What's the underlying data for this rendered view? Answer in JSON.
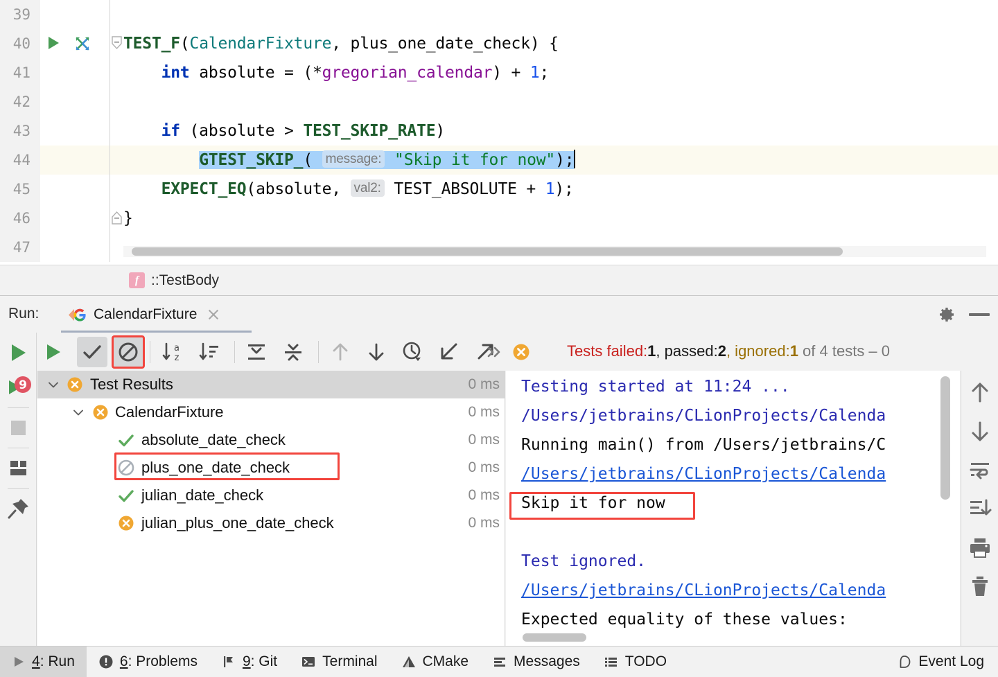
{
  "editor": {
    "lines": [
      {
        "no": "39",
        "segments": []
      },
      {
        "no": "40",
        "has_run_icon": true,
        "has_test_icon": true,
        "has_fold": "open",
        "text": "TEST_F(CalendarFixture, plus_one_date_check) {"
      },
      {
        "no": "41",
        "text": "    int absolute = (*gregorian_calendar) + 1;"
      },
      {
        "no": "42",
        "text": ""
      },
      {
        "no": "43",
        "text": "    if (absolute > TEST_SKIP_RATE)"
      },
      {
        "no": "44",
        "current": true,
        "text": "        GTEST_SKIP_( message: \"Skip it for now\");"
      },
      {
        "no": "45",
        "text": "    EXPECT_EQ(absolute,  val2: TEST_ABSOLUTE + 1);"
      },
      {
        "no": "46",
        "has_fold": "close",
        "text": "}"
      },
      {
        "no": "47",
        "text": ""
      }
    ],
    "hint_message": "message:",
    "hint_val2": "val2:",
    "code_tokens": {
      "l40_macro": "TEST_F",
      "l40_paren": "(",
      "l40_class": "CalendarFixture",
      "l40_rest": ", plus_one_date_check) {",
      "l41_indent": "    ",
      "l41_kw": "int",
      "l41_mid": " absolute = (*",
      "l41_field": "gregorian_calendar",
      "l41_end": ") + ",
      "l41_num": "1",
      "l41_semi": ";",
      "l43_indent": "    ",
      "l43_kw": "if",
      "l43_mid": " (absolute > ",
      "l43_const": "TEST_SKIP_RATE",
      "l43_end": ")",
      "l44_indent": "        ",
      "l44_macro": "GTEST_SKIP_",
      "l44_paren": "( ",
      "l44_str": "\"Skip it for now\"",
      "l44_end": ");",
      "l45_indent": "    ",
      "l45_macro": "EXPECT_EQ",
      "l45_mid": "(absolute, ",
      "l45_const": " TEST_ABSOLUTE + ",
      "l45_num": "1",
      "l45_end": ");",
      "l46_brace": "}"
    }
  },
  "breadcrumb": {
    "icon": "function-icon",
    "icon_letter": "f",
    "text": "::TestBody"
  },
  "run_header": {
    "label": "Run:",
    "tab_title": "CalendarFixture",
    "tab_icon": "gtest-icon",
    "close_icon": "close-icon",
    "gear_icon": "gear-icon",
    "minimize_icon": "minimize-icon"
  },
  "left_toolbar": {
    "buttons": [
      {
        "name": "rerun-button",
        "icon": "play-icon"
      },
      {
        "name": "rerun-failed-button",
        "icon": "play-failed-icon",
        "badge": "9"
      },
      {
        "name": "stop-button",
        "icon": "stop-icon"
      },
      {
        "name": "layout-button",
        "icon": "layout-icon"
      },
      {
        "name": "pin-tab-button",
        "icon": "pin-icon"
      }
    ]
  },
  "test_toolbar": {
    "buttons": [
      {
        "name": "rerun-tests-button",
        "icon": "play-icon",
        "state": "normal"
      },
      {
        "name": "show-passed-button",
        "icon": "check-icon",
        "state": "pressed"
      },
      {
        "name": "show-ignored-button",
        "icon": "ignored-icon",
        "state": "pressed-highlighted"
      },
      {
        "name": "sort-alphabetically-button",
        "icon": "sort-alpha-icon",
        "state": "normal"
      },
      {
        "name": "sort-by-duration-button",
        "icon": "sort-duration-icon",
        "state": "normal"
      },
      {
        "name": "expand-all-button",
        "icon": "expand-all-icon",
        "state": "normal"
      },
      {
        "name": "collapse-all-button",
        "icon": "collapse-all-icon",
        "state": "normal"
      },
      {
        "name": "previous-failed-button",
        "icon": "arrow-up-icon",
        "state": "disabled"
      },
      {
        "name": "next-failed-button",
        "icon": "arrow-down-icon",
        "state": "normal"
      },
      {
        "name": "test-history-button",
        "icon": "clock-dropdown-icon",
        "state": "normal"
      },
      {
        "name": "import-tests-button",
        "icon": "import-icon",
        "state": "normal"
      },
      {
        "name": "export-tests-button",
        "icon": "export-icon",
        "state": "normal"
      },
      {
        "name": "more-toolbar-button",
        "icon": "chevron-double-right-icon",
        "state": "normal"
      }
    ],
    "status": {
      "icon": "failed-icon",
      "failed_label": "Tests failed:",
      "failed_count": "1",
      "passed_label": ", passed:",
      "passed_count": "2",
      "ignored_label": ", ignored:",
      "ignored_count": "1",
      "total_text": " of 4 tests – 0"
    }
  },
  "test_tree": {
    "rows": [
      {
        "label": "Test Results",
        "time": "0 ms",
        "status": "failed",
        "indent": 0,
        "chevron": "expanded",
        "selected": true
      },
      {
        "label": "CalendarFixture",
        "time": "0 ms",
        "status": "failed",
        "indent": 1,
        "chevron": "expanded",
        "selected": false
      },
      {
        "label": "absolute_date_check",
        "time": "0 ms",
        "status": "passed",
        "indent": 2,
        "chevron": "none",
        "selected": false
      },
      {
        "label": "plus_one_date_check",
        "time": "0 ms",
        "status": "ignored",
        "indent": 2,
        "chevron": "none",
        "selected": false,
        "highlighted": true
      },
      {
        "label": "julian_date_check",
        "time": "0 ms",
        "status": "passed",
        "indent": 2,
        "chevron": "none",
        "selected": false
      },
      {
        "label": "julian_plus_one_date_check",
        "time": "0 ms",
        "status": "failed",
        "indent": 2,
        "chevron": "none",
        "selected": false
      }
    ]
  },
  "console": {
    "lines": [
      {
        "text": "Testing started at 11:24 ...",
        "style": "blue"
      },
      {
        "text": "/Users/jetbrains/CLionProjects/Calenda",
        "style": "blue"
      },
      {
        "text": "Running main() from /Users/jetbrains/C",
        "style": "black"
      },
      {
        "text": "/Users/jetbrains/CLionProjects/Calenda",
        "style": "link"
      },
      {
        "text": "Skip it for now",
        "style": "black",
        "highlighted": true
      },
      {
        "text": "",
        "style": "black"
      },
      {
        "text": "Test ignored.",
        "style": "blue"
      },
      {
        "text": "/Users/jetbrains/CLionProjects/Calenda",
        "style": "link"
      },
      {
        "text": "Expected equality of these values:",
        "style": "black"
      }
    ]
  },
  "right_toolbar": {
    "buttons": [
      {
        "name": "scroll-up-button",
        "icon": "arrow-up-icon"
      },
      {
        "name": "scroll-down-button",
        "icon": "arrow-down-icon"
      },
      {
        "name": "soft-wrap-button",
        "icon": "soft-wrap-icon"
      },
      {
        "name": "scroll-to-end-button",
        "icon": "scroll-end-icon"
      },
      {
        "name": "print-button",
        "icon": "print-icon"
      },
      {
        "name": "clear-all-button",
        "icon": "trash-icon"
      }
    ]
  },
  "status_bar": {
    "items": [
      {
        "name": "statusbar-run",
        "num": "4",
        "label": ": Run",
        "icon": "play-icon",
        "active": true
      },
      {
        "name": "statusbar-problems",
        "num": "6",
        "label": ": Problems",
        "icon": "problems-icon",
        "active": false
      },
      {
        "name": "statusbar-git",
        "num": "9",
        "label": ": Git",
        "icon": "git-icon",
        "active": false
      },
      {
        "name": "statusbar-terminal",
        "num": "",
        "label": "Terminal",
        "icon": "terminal-icon",
        "active": false
      },
      {
        "name": "statusbar-cmake",
        "num": "",
        "label": "CMake",
        "icon": "cmake-icon",
        "active": false
      },
      {
        "name": "statusbar-messages",
        "num": "",
        "label": "Messages",
        "icon": "messages-icon",
        "active": false
      },
      {
        "name": "statusbar-todo",
        "num": "",
        "label": "TODO",
        "icon": "todo-icon",
        "active": false
      }
    ],
    "event_log": {
      "name": "statusbar-event-log",
      "label": "Event Log",
      "icon": "event-log-icon"
    }
  },
  "colors": {
    "accent_red": "#f2453d",
    "failed": "#c9211e",
    "ignored": "#9a7005",
    "passed_green": "#499c54",
    "selection": "#a6d2fa",
    "current_line": "#fcfaef"
  }
}
